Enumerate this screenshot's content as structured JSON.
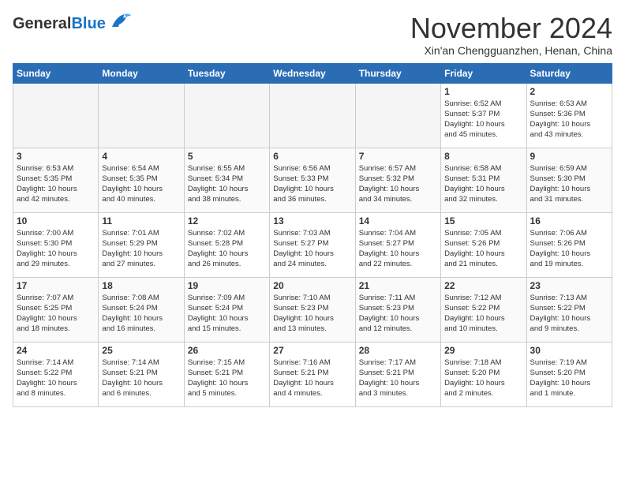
{
  "header": {
    "logo_general": "General",
    "logo_blue": "Blue",
    "month_title": "November 2024",
    "location": "Xin'an Chengguanzhen, Henan, China"
  },
  "days_of_week": [
    "Sunday",
    "Monday",
    "Tuesday",
    "Wednesday",
    "Thursday",
    "Friday",
    "Saturday"
  ],
  "weeks": [
    [
      {
        "num": "",
        "info": "",
        "empty": true
      },
      {
        "num": "",
        "info": "",
        "empty": true
      },
      {
        "num": "",
        "info": "",
        "empty": true
      },
      {
        "num": "",
        "info": "",
        "empty": true
      },
      {
        "num": "",
        "info": "",
        "empty": true
      },
      {
        "num": "1",
        "info": "Sunrise: 6:52 AM\nSunset: 5:37 PM\nDaylight: 10 hours\nand 45 minutes.",
        "empty": false
      },
      {
        "num": "2",
        "info": "Sunrise: 6:53 AM\nSunset: 5:36 PM\nDaylight: 10 hours\nand 43 minutes.",
        "empty": false
      }
    ],
    [
      {
        "num": "3",
        "info": "Sunrise: 6:53 AM\nSunset: 5:35 PM\nDaylight: 10 hours\nand 42 minutes.",
        "empty": false
      },
      {
        "num": "4",
        "info": "Sunrise: 6:54 AM\nSunset: 5:35 PM\nDaylight: 10 hours\nand 40 minutes.",
        "empty": false
      },
      {
        "num": "5",
        "info": "Sunrise: 6:55 AM\nSunset: 5:34 PM\nDaylight: 10 hours\nand 38 minutes.",
        "empty": false
      },
      {
        "num": "6",
        "info": "Sunrise: 6:56 AM\nSunset: 5:33 PM\nDaylight: 10 hours\nand 36 minutes.",
        "empty": false
      },
      {
        "num": "7",
        "info": "Sunrise: 6:57 AM\nSunset: 5:32 PM\nDaylight: 10 hours\nand 34 minutes.",
        "empty": false
      },
      {
        "num": "8",
        "info": "Sunrise: 6:58 AM\nSunset: 5:31 PM\nDaylight: 10 hours\nand 32 minutes.",
        "empty": false
      },
      {
        "num": "9",
        "info": "Sunrise: 6:59 AM\nSunset: 5:30 PM\nDaylight: 10 hours\nand 31 minutes.",
        "empty": false
      }
    ],
    [
      {
        "num": "10",
        "info": "Sunrise: 7:00 AM\nSunset: 5:30 PM\nDaylight: 10 hours\nand 29 minutes.",
        "empty": false
      },
      {
        "num": "11",
        "info": "Sunrise: 7:01 AM\nSunset: 5:29 PM\nDaylight: 10 hours\nand 27 minutes.",
        "empty": false
      },
      {
        "num": "12",
        "info": "Sunrise: 7:02 AM\nSunset: 5:28 PM\nDaylight: 10 hours\nand 26 minutes.",
        "empty": false
      },
      {
        "num": "13",
        "info": "Sunrise: 7:03 AM\nSunset: 5:27 PM\nDaylight: 10 hours\nand 24 minutes.",
        "empty": false
      },
      {
        "num": "14",
        "info": "Sunrise: 7:04 AM\nSunset: 5:27 PM\nDaylight: 10 hours\nand 22 minutes.",
        "empty": false
      },
      {
        "num": "15",
        "info": "Sunrise: 7:05 AM\nSunset: 5:26 PM\nDaylight: 10 hours\nand 21 minutes.",
        "empty": false
      },
      {
        "num": "16",
        "info": "Sunrise: 7:06 AM\nSunset: 5:26 PM\nDaylight: 10 hours\nand 19 minutes.",
        "empty": false
      }
    ],
    [
      {
        "num": "17",
        "info": "Sunrise: 7:07 AM\nSunset: 5:25 PM\nDaylight: 10 hours\nand 18 minutes.",
        "empty": false
      },
      {
        "num": "18",
        "info": "Sunrise: 7:08 AM\nSunset: 5:24 PM\nDaylight: 10 hours\nand 16 minutes.",
        "empty": false
      },
      {
        "num": "19",
        "info": "Sunrise: 7:09 AM\nSunset: 5:24 PM\nDaylight: 10 hours\nand 15 minutes.",
        "empty": false
      },
      {
        "num": "20",
        "info": "Sunrise: 7:10 AM\nSunset: 5:23 PM\nDaylight: 10 hours\nand 13 minutes.",
        "empty": false
      },
      {
        "num": "21",
        "info": "Sunrise: 7:11 AM\nSunset: 5:23 PM\nDaylight: 10 hours\nand 12 minutes.",
        "empty": false
      },
      {
        "num": "22",
        "info": "Sunrise: 7:12 AM\nSunset: 5:22 PM\nDaylight: 10 hours\nand 10 minutes.",
        "empty": false
      },
      {
        "num": "23",
        "info": "Sunrise: 7:13 AM\nSunset: 5:22 PM\nDaylight: 10 hours\nand 9 minutes.",
        "empty": false
      }
    ],
    [
      {
        "num": "24",
        "info": "Sunrise: 7:14 AM\nSunset: 5:22 PM\nDaylight: 10 hours\nand 8 minutes.",
        "empty": false
      },
      {
        "num": "25",
        "info": "Sunrise: 7:14 AM\nSunset: 5:21 PM\nDaylight: 10 hours\nand 6 minutes.",
        "empty": false
      },
      {
        "num": "26",
        "info": "Sunrise: 7:15 AM\nSunset: 5:21 PM\nDaylight: 10 hours\nand 5 minutes.",
        "empty": false
      },
      {
        "num": "27",
        "info": "Sunrise: 7:16 AM\nSunset: 5:21 PM\nDaylight: 10 hours\nand 4 minutes.",
        "empty": false
      },
      {
        "num": "28",
        "info": "Sunrise: 7:17 AM\nSunset: 5:21 PM\nDaylight: 10 hours\nand 3 minutes.",
        "empty": false
      },
      {
        "num": "29",
        "info": "Sunrise: 7:18 AM\nSunset: 5:20 PM\nDaylight: 10 hours\nand 2 minutes.",
        "empty": false
      },
      {
        "num": "30",
        "info": "Sunrise: 7:19 AM\nSunset: 5:20 PM\nDaylight: 10 hours\nand 1 minute.",
        "empty": false
      }
    ]
  ]
}
